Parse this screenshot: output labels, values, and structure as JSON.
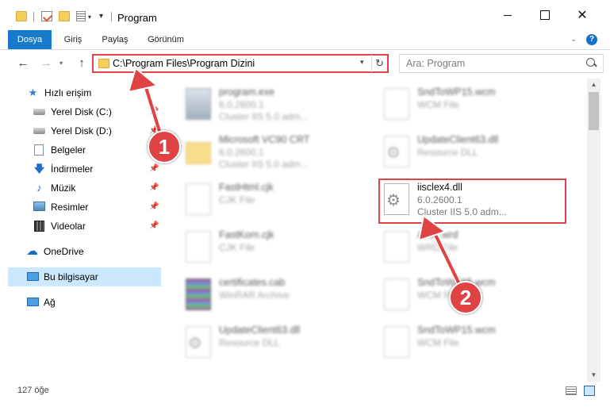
{
  "titlebar": {
    "title": "Program",
    "controls": {
      "close_glyph": "✕"
    }
  },
  "ribbon": {
    "tabs": [
      {
        "label": "Dosya"
      },
      {
        "label": "Giriş"
      },
      {
        "label": "Paylaş"
      },
      {
        "label": "Görünüm"
      }
    ],
    "help_glyph": "?"
  },
  "navbar": {
    "back_glyph": "←",
    "forward_glyph": "→",
    "up_glyph": "↑",
    "address": "C:\\Program Files\\Program Dizini",
    "refresh_glyph": "↻",
    "search_placeholder": "Ara: Program"
  },
  "sidebar": {
    "quick_access": "Hızlı erişim",
    "items": [
      {
        "label": "Yerel Disk (C:)",
        "icon": "disk-icon",
        "pinned": true
      },
      {
        "label": "Yerel Disk (D:)",
        "icon": "disk-icon",
        "pinned": true
      },
      {
        "label": "Belgeler",
        "icon": "document-icon",
        "pinned": true
      },
      {
        "label": "İndirmeler",
        "icon": "download-icon",
        "pinned": true
      },
      {
        "label": "Müzik",
        "icon": "music-icon",
        "pinned": true
      },
      {
        "label": "Resimler",
        "icon": "pictures-icon",
        "pinned": true
      },
      {
        "label": "Videolar",
        "icon": "video-icon",
        "pinned": true
      }
    ],
    "onedrive": "OneDrive",
    "this_pc": "Bu bilgisayar",
    "network": "Ağ"
  },
  "files": {
    "left": [
      {
        "name": "program.exe",
        "line1": "6.0.2600.1",
        "line2": "Cluster IIS 5.0 adm...",
        "icon": "exe"
      },
      {
        "name": "Microsoft VC90 CRT",
        "line1": "6.0.2600.1",
        "line2": "Cluster IIS 5.0 adm...",
        "icon": "folder"
      },
      {
        "name": "FastHtml.cjk",
        "line1": "CJK File",
        "line2": "",
        "icon": "blank"
      },
      {
        "name": "FastKorn.cjk",
        "line1": "CJK File",
        "line2": "",
        "icon": "blank"
      },
      {
        "name": "certificates.cab",
        "line1": "WinRAR Archive",
        "line2": "",
        "icon": "cab"
      },
      {
        "name": "UpdateClient63.dll",
        "line1": "Resource DLL",
        "line2": "",
        "icon": "gear"
      }
    ],
    "right": [
      {
        "name": "SndToWP15.wcm",
        "line1": "WCM File",
        "line2": "",
        "icon": "blank"
      },
      {
        "name": "UpdateClient63.dll",
        "line1": "Resource DLL",
        "line2": "",
        "icon": "gear"
      },
      {
        "name": "iisclex4.dll",
        "line1": "6.0.2600.1",
        "line2": "Cluster IIS 5.0 adm...",
        "icon": "gear"
      },
      {
        "name": "Actxt.wrd",
        "line1": "WRD File",
        "line2": "",
        "icon": "blank"
      },
      {
        "name": "SndToWP15.wcm",
        "line1": "WCM File",
        "line2": "",
        "icon": "blank"
      },
      {
        "name": "SndToWP15.wcm",
        "line1": "WCM File",
        "line2": "",
        "icon": "blank"
      }
    ]
  },
  "status": {
    "count": "127 öğe"
  },
  "annotations": {
    "badge1": "1",
    "badge2": "2",
    "color": "#e04344"
  }
}
